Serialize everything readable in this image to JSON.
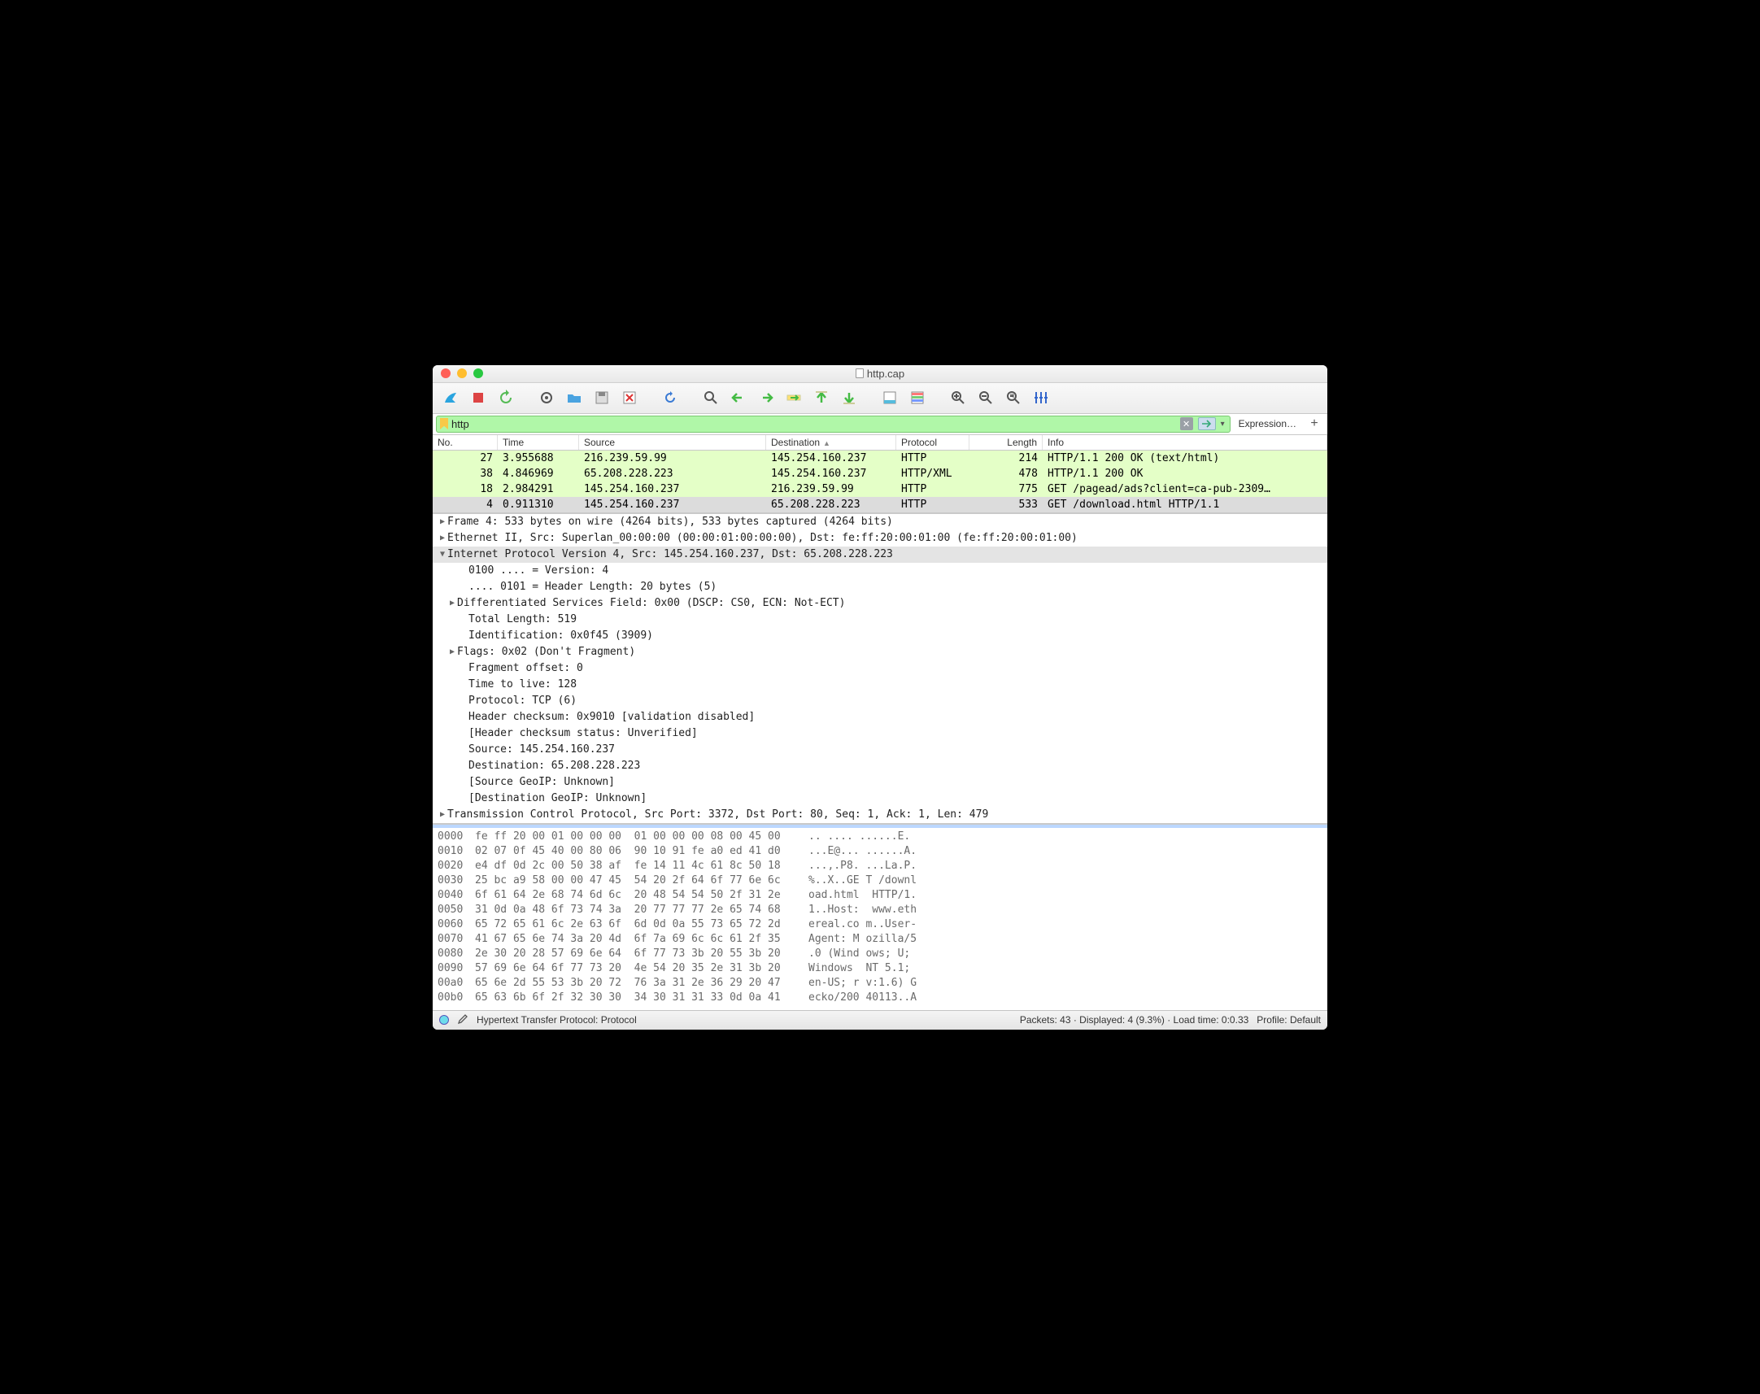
{
  "window": {
    "title": "http.cap"
  },
  "filter": {
    "value": "http",
    "expression_label": "Expression…",
    "plus_label": "+"
  },
  "columns": {
    "no": "No.",
    "time": "Time",
    "source": "Source",
    "destination": "Destination",
    "protocol": "Protocol",
    "length": "Length",
    "info": "Info"
  },
  "packets": [
    {
      "no": "27",
      "time": "3.955688",
      "src": "216.239.59.99",
      "dst": "145.254.160.237",
      "proto": "HTTP",
      "len": "214",
      "info": "HTTP/1.1 200 OK  (text/html)",
      "cls": "row-http"
    },
    {
      "no": "38",
      "time": "4.846969",
      "src": "65.208.228.223",
      "dst": "145.254.160.237",
      "proto": "HTTP/XML",
      "len": "478",
      "info": "HTTP/1.1 200 OK",
      "cls": "row-http"
    },
    {
      "no": "18",
      "time": "2.984291",
      "src": "145.254.160.237",
      "dst": "216.239.59.99",
      "proto": "HTTP",
      "len": "775",
      "info": "GET /pagead/ads?client=ca-pub-2309…",
      "cls": "row-http"
    },
    {
      "no": "4",
      "time": "0.911310",
      "src": "145.254.160.237",
      "dst": "65.208.228.223",
      "proto": "HTTP",
      "len": "533",
      "info": "GET /download.html HTTP/1.1",
      "cls": "row-sel"
    }
  ],
  "tree": [
    {
      "tri": "▶",
      "txt": "Frame 4: 533 bytes on wire (4264 bits), 533 bytes captured (4264 bits)",
      "ind": ""
    },
    {
      "tri": "▶",
      "txt": "Ethernet II, Src: Superlan_00:00:00 (00:00:01:00:00:00), Dst: fe:ff:20:00:01:00 (fe:ff:20:00:01:00)",
      "ind": ""
    },
    {
      "tri": "▼",
      "txt": "Internet Protocol Version 4, Src: 145.254.160.237, Dst: 65.208.228.223",
      "ind": "",
      "sel": true
    },
    {
      "tri": "",
      "txt": "0100 .... = Version: 4",
      "ind": "indent2"
    },
    {
      "tri": "",
      "txt": ".... 0101 = Header Length: 20 bytes (5)",
      "ind": "indent2"
    },
    {
      "tri": "▶",
      "txt": "Differentiated Services Field: 0x00 (DSCP: CS0, ECN: Not-ECT)",
      "ind": "indent1"
    },
    {
      "tri": "",
      "txt": "Total Length: 519",
      "ind": "indent2"
    },
    {
      "tri": "",
      "txt": "Identification: 0x0f45 (3909)",
      "ind": "indent2"
    },
    {
      "tri": "▶",
      "txt": "Flags: 0x02 (Don't Fragment)",
      "ind": "indent1"
    },
    {
      "tri": "",
      "txt": "Fragment offset: 0",
      "ind": "indent2"
    },
    {
      "tri": "",
      "txt": "Time to live: 128",
      "ind": "indent2"
    },
    {
      "tri": "",
      "txt": "Protocol: TCP (6)",
      "ind": "indent2"
    },
    {
      "tri": "",
      "txt": "Header checksum: 0x9010 [validation disabled]",
      "ind": "indent2"
    },
    {
      "tri": "",
      "txt": "[Header checksum status: Unverified]",
      "ind": "indent2"
    },
    {
      "tri": "",
      "txt": "Source: 145.254.160.237",
      "ind": "indent2"
    },
    {
      "tri": "",
      "txt": "Destination: 65.208.228.223",
      "ind": "indent2"
    },
    {
      "tri": "",
      "txt": "[Source GeoIP: Unknown]",
      "ind": "indent2"
    },
    {
      "tri": "",
      "txt": "[Destination GeoIP: Unknown]",
      "ind": "indent2"
    },
    {
      "tri": "▶",
      "txt": "Transmission Control Protocol, Src Port: 3372, Dst Port: 80, Seq: 1, Ack: 1, Len: 479",
      "ind": ""
    }
  ],
  "hex": [
    {
      "off": "0000",
      "b": "fe ff 20 00 01 00 00 00  01 00 00 00 08 00 45 00",
      "a": ".. .... ......E."
    },
    {
      "off": "0010",
      "b": "02 07 0f 45 40 00 80 06  90 10 91 fe a0 ed 41 d0",
      "a": "...E@... ......A."
    },
    {
      "off": "0020",
      "b": "e4 df 0d 2c 00 50 38 af  fe 14 11 4c 61 8c 50 18",
      "a": "...,.P8. ...La.P."
    },
    {
      "off": "0030",
      "b": "25 bc a9 58 00 00 47 45  54 20 2f 64 6f 77 6e 6c",
      "a": "%..X..GE T /downl"
    },
    {
      "off": "0040",
      "b": "6f 61 64 2e 68 74 6d 6c  20 48 54 54 50 2f 31 2e",
      "a": "oad.html  HTTP/1."
    },
    {
      "off": "0050",
      "b": "31 0d 0a 48 6f 73 74 3a  20 77 77 77 2e 65 74 68",
      "a": "1..Host:  www.eth"
    },
    {
      "off": "0060",
      "b": "65 72 65 61 6c 2e 63 6f  6d 0d 0a 55 73 65 72 2d",
      "a": "ereal.co m..User-"
    },
    {
      "off": "0070",
      "b": "41 67 65 6e 74 3a 20 4d  6f 7a 69 6c 6c 61 2f 35",
      "a": "Agent: M ozilla/5"
    },
    {
      "off": "0080",
      "b": "2e 30 20 28 57 69 6e 64  6f 77 73 3b 20 55 3b 20",
      "a": ".0 (Wind ows; U; "
    },
    {
      "off": "0090",
      "b": "57 69 6e 64 6f 77 73 20  4e 54 20 35 2e 31 3b 20",
      "a": "Windows  NT 5.1; "
    },
    {
      "off": "00a0",
      "b": "65 6e 2d 55 53 3b 20 72  76 3a 31 2e 36 29 20 47",
      "a": "en-US; r v:1.6) G"
    },
    {
      "off": "00b0",
      "b": "65 63 6b 6f 2f 32 30 30  34 30 31 31 33 0d 0a 41",
      "a": "ecko/200 40113..A"
    }
  ],
  "status": {
    "left": "Hypertext Transfer Protocol: Protocol",
    "mid": "Packets: 43 · Displayed: 4 (9.3%) · Load time: 0:0.33",
    "right": "Profile: Default"
  },
  "toolbar_icons": [
    "shark-fin-icon",
    "stop-icon",
    "restart-icon",
    "options-icon",
    "open-icon",
    "save-icon",
    "close-file-icon",
    "reload-icon",
    "find-icon",
    "prev-icon",
    "next-icon",
    "goto-icon",
    "first-icon",
    "last-icon",
    "autoscroll-icon",
    "colorize-icon",
    "zoom-in-icon",
    "zoom-out-icon",
    "zoom-reset-icon",
    "resize-cols-icon"
  ]
}
